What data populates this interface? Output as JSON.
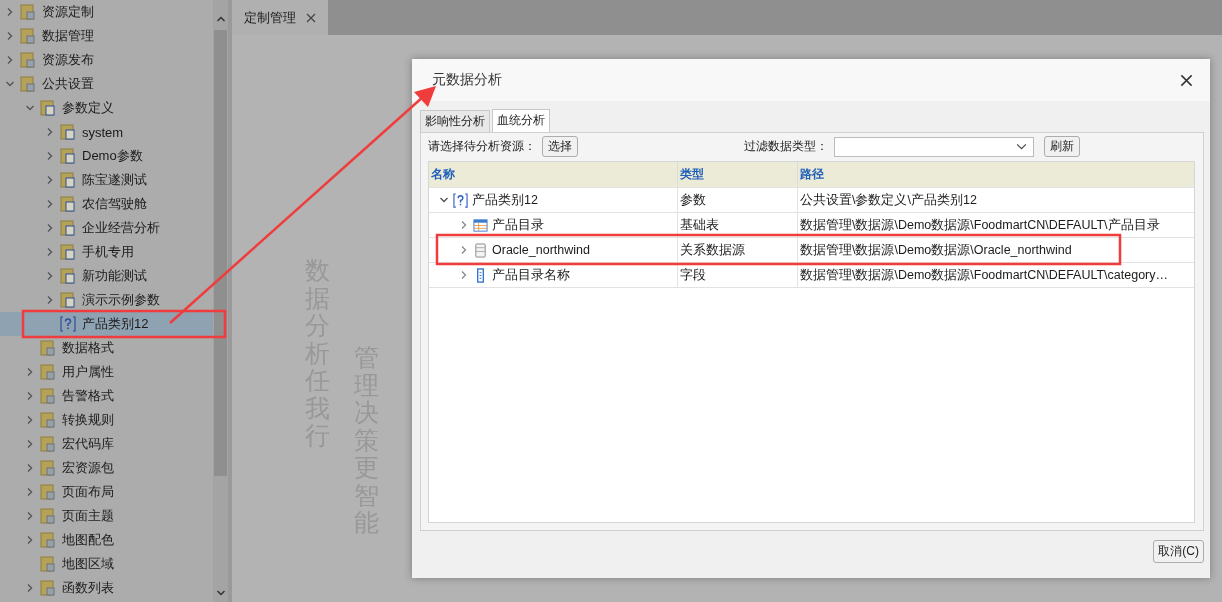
{
  "sidebar": {
    "items": [
      {
        "label": "资源定制",
        "expanded": false,
        "selected": false
      },
      {
        "label": "数据管理",
        "expanded": false,
        "selected": false
      },
      {
        "label": "资源发布",
        "expanded": false,
        "selected": false
      },
      {
        "label": "公共设置",
        "expanded": true,
        "selected": false,
        "children": [
          {
            "label": "参数定义",
            "expanded": true,
            "selected": false,
            "children": [
              {
                "label": "system",
                "expanded": false,
                "selected": false
              },
              {
                "label": "Demo参数",
                "expanded": false,
                "selected": false
              },
              {
                "label": "陈宝遂测试",
                "expanded": false,
                "selected": false
              },
              {
                "label": "农信驾驶舱",
                "expanded": false,
                "selected": false
              },
              {
                "label": "企业经营分析",
                "expanded": false,
                "selected": false
              },
              {
                "label": "手机专用",
                "expanded": false,
                "selected": false
              },
              {
                "label": "新功能测试",
                "expanded": false,
                "selected": false
              },
              {
                "label": "演示示例参数",
                "expanded": false,
                "selected": false
              },
              {
                "label": "产品类别12",
                "selected": true
              }
            ]
          },
          {
            "label": "数据格式",
            "selected": false
          },
          {
            "label": "用户属性",
            "expanded": false,
            "selected": false
          },
          {
            "label": "告警格式",
            "expanded": false,
            "selected": false
          },
          {
            "label": "转换规则",
            "expanded": false,
            "selected": false
          },
          {
            "label": "宏代码库",
            "expanded": false,
            "selected": false
          },
          {
            "label": "宏资源包",
            "expanded": false,
            "selected": false
          },
          {
            "label": "页面布局",
            "expanded": false,
            "selected": false
          },
          {
            "label": "页面主题",
            "expanded": false,
            "selected": false
          },
          {
            "label": "地图配色",
            "expanded": false,
            "selected": false
          },
          {
            "label": "地图区域",
            "selected": false
          },
          {
            "label": "函数列表",
            "expanded": false,
            "selected": false
          }
        ]
      }
    ]
  },
  "tabs": [
    {
      "label": "定制管理",
      "selected": true
    }
  ],
  "background_slogans": [
    "数据分析任我行",
    "管理决策更智能"
  ],
  "dialog": {
    "title": "元数据分析",
    "tabs": [
      {
        "label": "影响性分析",
        "selected": false
      },
      {
        "label": "血统分析",
        "selected": true
      }
    ],
    "resource_label": "请选择待分析资源：",
    "select_button": "选择",
    "filter_label": "过滤数据类型：",
    "refresh_button": "刷新",
    "table": {
      "columns": [
        "名称",
        "类型",
        "路径"
      ],
      "rows": [
        {
          "kind": "parameter",
          "name": "产品类别12",
          "type": "参数",
          "path": "公共设置\\参数定义\\产品类别12",
          "expanded": true,
          "children": [
            {
              "kind": "table",
              "name": "产品目录",
              "type": "基础表",
              "path": "数据管理\\数据源\\Demo数据源\\FoodmartCN\\DEFAULT\\产品目录",
              "expanded": false
            },
            {
              "kind": "datasource",
              "name": "Oracle_northwind",
              "type": "关系数据源",
              "path": "数据管理\\数据源\\Demo数据源\\Oracle_northwind",
              "expanded": false
            },
            {
              "kind": "field",
              "name": "产品目录名称",
              "type": "字段",
              "path": "数据管理\\数据源\\Demo数据源\\FoodmartCN\\DEFAULT\\category…",
              "expanded": false
            }
          ]
        }
      ]
    },
    "cancel_button": "取消(C)"
  }
}
